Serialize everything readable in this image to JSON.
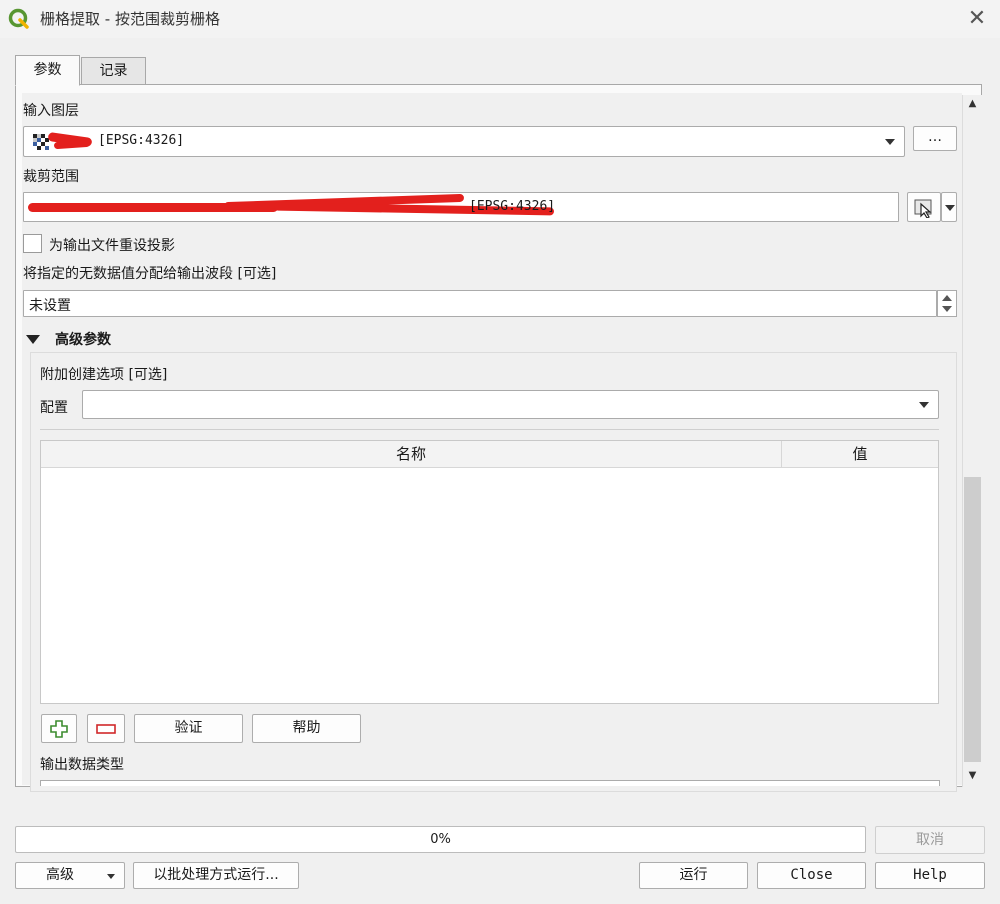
{
  "window": {
    "title": "栅格提取 - 按范围裁剪栅格",
    "close_icon": "✕"
  },
  "tabs": [
    {
      "label": "参数",
      "active": true
    },
    {
      "label": "记录",
      "active": false
    }
  ],
  "params": {
    "input_layer": {
      "label": "输入图层",
      "value": "[EPSG:4326]",
      "browse_label": "…"
    },
    "extent": {
      "label": "裁剪范围",
      "value": "[EPSG:4326]"
    },
    "override_projection": {
      "label": "为输出文件重设投影",
      "checked": false
    },
    "nodata": {
      "label": "将指定的无数据值分配给输出波段 [可选]",
      "value": "未设置"
    },
    "advanced": {
      "header": "高级参数",
      "creation_options_label": "附加创建选项 [可选]",
      "profile_label": "配置",
      "profile_value": "",
      "table": {
        "columns": [
          "名称",
          "值"
        ]
      },
      "validate_label": "验证",
      "help_label": "帮助",
      "output_type_label": "输出数据类型"
    }
  },
  "footer": {
    "progress_text": "0%",
    "progress": 0,
    "cancel_label": "取消",
    "advanced_label": "高级",
    "batch_label": "以批处理方式运行...",
    "run_label": "运行",
    "close_label": "Close",
    "help_label": "Help"
  },
  "colors": {
    "qgis_green": "#589632",
    "redaction": "#e3201d"
  }
}
